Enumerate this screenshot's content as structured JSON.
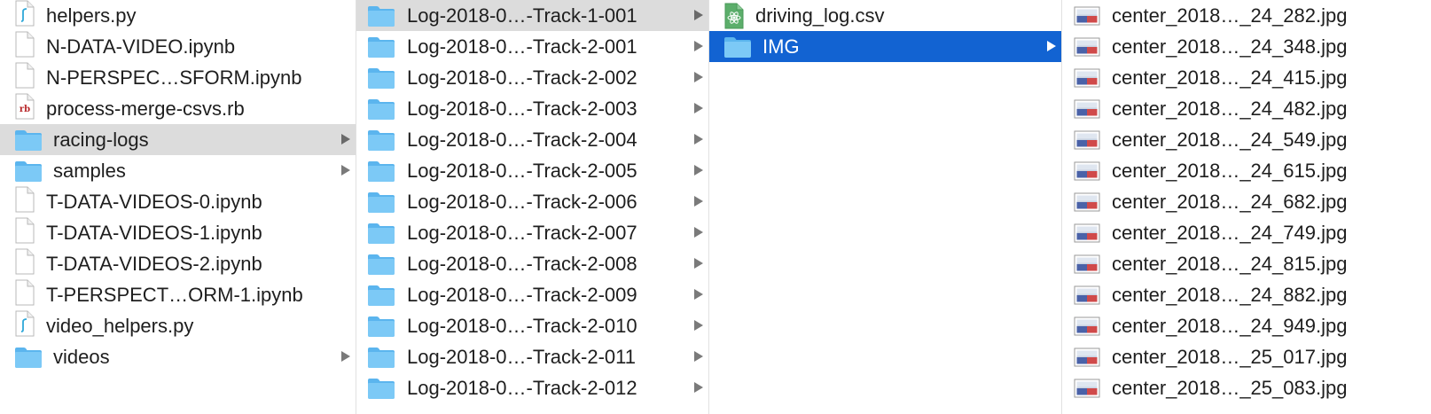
{
  "columns": [
    {
      "id": "col1",
      "items": [
        {
          "name": "helpers.py",
          "icon": "python-file-icon",
          "selected": "",
          "has_children": false
        },
        {
          "name": "N-DATA-VIDEO.ipynb",
          "icon": "document-icon",
          "selected": "",
          "has_children": false
        },
        {
          "name": "N-PERSPEC…SFORM.ipynb",
          "icon": "document-icon",
          "selected": "",
          "has_children": false
        },
        {
          "name": "process-merge-csvs.rb",
          "icon": "ruby-file-icon",
          "selected": "",
          "has_children": false
        },
        {
          "name": "racing-logs",
          "icon": "folder-icon",
          "selected": "gray",
          "has_children": true
        },
        {
          "name": "samples",
          "icon": "folder-icon",
          "selected": "",
          "has_children": true
        },
        {
          "name": "T-DATA-VIDEOS-0.ipynb",
          "icon": "document-icon",
          "selected": "",
          "has_children": false
        },
        {
          "name": "T-DATA-VIDEOS-1.ipynb",
          "icon": "document-icon",
          "selected": "",
          "has_children": false
        },
        {
          "name": "T-DATA-VIDEOS-2.ipynb",
          "icon": "document-icon",
          "selected": "",
          "has_children": false
        },
        {
          "name": "T-PERSPECT…ORM-1.ipynb",
          "icon": "document-icon",
          "selected": "",
          "has_children": false
        },
        {
          "name": "video_helpers.py",
          "icon": "python-file-icon",
          "selected": "",
          "has_children": false
        },
        {
          "name": "videos",
          "icon": "folder-icon",
          "selected": "",
          "has_children": true
        }
      ]
    },
    {
      "id": "col2",
      "items": [
        {
          "name": "Log-2018-0…-Track-1-001",
          "icon": "folder-icon",
          "selected": "gray",
          "has_children": true
        },
        {
          "name": "Log-2018-0…-Track-2-001",
          "icon": "folder-icon",
          "selected": "",
          "has_children": true
        },
        {
          "name": "Log-2018-0…-Track-2-002",
          "icon": "folder-icon",
          "selected": "",
          "has_children": true
        },
        {
          "name": "Log-2018-0…-Track-2-003",
          "icon": "folder-icon",
          "selected": "",
          "has_children": true
        },
        {
          "name": "Log-2018-0…-Track-2-004",
          "icon": "folder-icon",
          "selected": "",
          "has_children": true
        },
        {
          "name": "Log-2018-0…-Track-2-005",
          "icon": "folder-icon",
          "selected": "",
          "has_children": true
        },
        {
          "name": "Log-2018-0…-Track-2-006",
          "icon": "folder-icon",
          "selected": "",
          "has_children": true
        },
        {
          "name": "Log-2018-0…-Track-2-007",
          "icon": "folder-icon",
          "selected": "",
          "has_children": true
        },
        {
          "name": "Log-2018-0…-Track-2-008",
          "icon": "folder-icon",
          "selected": "",
          "has_children": true
        },
        {
          "name": "Log-2018-0…-Track-2-009",
          "icon": "folder-icon",
          "selected": "",
          "has_children": true
        },
        {
          "name": "Log-2018-0…-Track-2-010",
          "icon": "folder-icon",
          "selected": "",
          "has_children": true
        },
        {
          "name": "Log-2018-0…-Track-2-011",
          "icon": "folder-icon",
          "selected": "",
          "has_children": true
        },
        {
          "name": "Log-2018-0…-Track-2-012",
          "icon": "folder-icon",
          "selected": "",
          "has_children": true
        }
      ]
    },
    {
      "id": "col3",
      "items": [
        {
          "name": "driving_log.csv",
          "icon": "csv-file-icon",
          "selected": "",
          "has_children": false
        },
        {
          "name": "IMG",
          "icon": "folder-icon",
          "selected": "blue",
          "has_children": true
        }
      ]
    },
    {
      "id": "col4",
      "items": [
        {
          "name": "center_2018…_24_282.jpg",
          "icon": "jpg-image-icon",
          "selected": "",
          "has_children": false
        },
        {
          "name": "center_2018…_24_348.jpg",
          "icon": "jpg-image-icon",
          "selected": "",
          "has_children": false
        },
        {
          "name": "center_2018…_24_415.jpg",
          "icon": "jpg-image-icon",
          "selected": "",
          "has_children": false
        },
        {
          "name": "center_2018…_24_482.jpg",
          "icon": "jpg-image-icon",
          "selected": "",
          "has_children": false
        },
        {
          "name": "center_2018…_24_549.jpg",
          "icon": "jpg-image-icon",
          "selected": "",
          "has_children": false
        },
        {
          "name": "center_2018…_24_615.jpg",
          "icon": "jpg-image-icon",
          "selected": "",
          "has_children": false
        },
        {
          "name": "center_2018…_24_682.jpg",
          "icon": "jpg-image-icon",
          "selected": "",
          "has_children": false
        },
        {
          "name": "center_2018…_24_749.jpg",
          "icon": "jpg-image-icon",
          "selected": "",
          "has_children": false
        },
        {
          "name": "center_2018…_24_815.jpg",
          "icon": "jpg-image-icon",
          "selected": "",
          "has_children": false
        },
        {
          "name": "center_2018…_24_882.jpg",
          "icon": "jpg-image-icon",
          "selected": "",
          "has_children": false
        },
        {
          "name": "center_2018…_24_949.jpg",
          "icon": "jpg-image-icon",
          "selected": "",
          "has_children": false
        },
        {
          "name": "center_2018…_25_017.jpg",
          "icon": "jpg-image-icon",
          "selected": "",
          "has_children": false
        },
        {
          "name": "center_2018…_25_083.jpg",
          "icon": "jpg-image-icon",
          "selected": "",
          "has_children": false
        }
      ]
    }
  ],
  "colors": {
    "selection_blue": "#1263d2",
    "selection_gray": "#dcdcdc",
    "folder_blue": "#6ec3f4",
    "text": "#1e1e1e"
  }
}
